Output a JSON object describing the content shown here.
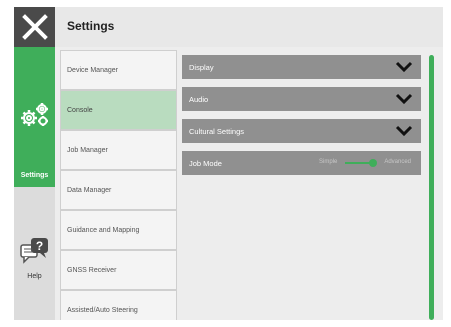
{
  "header": {
    "title": "Settings"
  },
  "sidebar": {
    "close_icon": "close-icon",
    "settings": {
      "label": "Settings",
      "icon": "gears-icon"
    },
    "help": {
      "label": "Help",
      "icon": "help-chat-icon"
    }
  },
  "menu": {
    "items": [
      {
        "label": "Device Manager"
      },
      {
        "label": "Console"
      },
      {
        "label": "Job Manager"
      },
      {
        "label": "Data Manager"
      },
      {
        "label": "Guidance and Mapping"
      },
      {
        "label": "GNSS Receiver"
      },
      {
        "label": "Assisted/Auto Steering"
      }
    ],
    "active_index": 1
  },
  "panel": {
    "rows": [
      {
        "label": "Display",
        "icon": "chevron-down-icon"
      },
      {
        "label": "Audio",
        "icon": "chevron-down-icon"
      },
      {
        "label": "Cultural Settings",
        "icon": "chevron-down-icon"
      },
      {
        "label": "Job Mode",
        "toggle": {
          "left": "Simple",
          "right": "Advanced",
          "selected": "Advanced"
        }
      }
    ]
  },
  "colors": {
    "accent": "#3fae5a",
    "row_bg": "#909090",
    "active_menu": "#b9dcbf",
    "dark": "#4a4a4a"
  }
}
